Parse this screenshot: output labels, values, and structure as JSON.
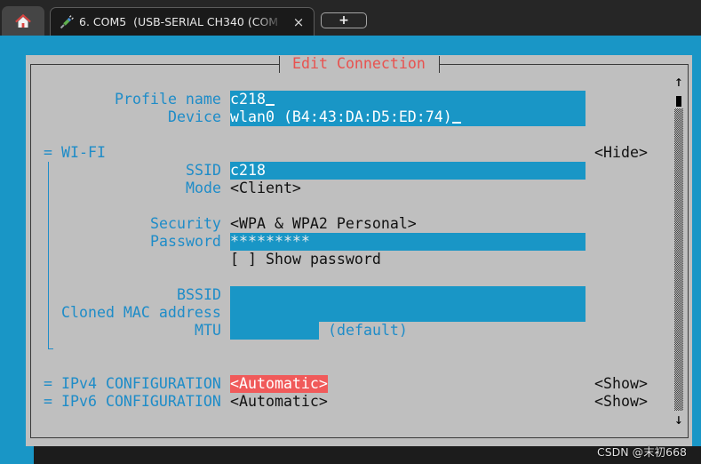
{
  "tab_bar": {
    "home_icon": "home-icon",
    "active_tab": {
      "icon": "serial-plug-icon",
      "label": "6. COM5  (USB-SERIAL CH340 (COM",
      "close_glyph": "×"
    },
    "new_tab_glyph": "+"
  },
  "dialog": {
    "title": "Edit Connection",
    "profile_name": {
      "label": "Profile name",
      "value": "c218"
    },
    "device": {
      "label": "Device",
      "value": "wlan0 (B4:43:DA:D5:ED:74)"
    },
    "wifi": {
      "marker": "=",
      "label": "WI-FI",
      "toggle": "<Hide>",
      "ssid": {
        "label": "SSID",
        "value": "c218"
      },
      "mode": {
        "label": "Mode",
        "value": "<Client>"
      },
      "security": {
        "label": "Security",
        "value": "<WPA & WPA2 Personal>"
      },
      "password": {
        "label": "Password",
        "value": "*********"
      },
      "show_password": {
        "checkbox": "[ ]",
        "label": "Show password",
        "checked": false
      },
      "bssid": {
        "label": "BSSID"
      },
      "cloned_mac": {
        "label": "Cloned MAC address"
      },
      "mtu": {
        "label": "MTU",
        "hint": "(default)"
      }
    },
    "ipv4": {
      "marker": "=",
      "label": "IPv4 CONFIGURATION",
      "value": "<Automatic>",
      "toggle": "<Show>",
      "focused": true
    },
    "ipv6": {
      "marker": "=",
      "label": "IPv6 CONFIGURATION",
      "value": "<Automatic>",
      "toggle": "<Show>"
    },
    "scrollbar": {
      "up_glyph": "↑",
      "down_glyph": "↓"
    }
  },
  "watermark": "CSDN @末初668",
  "colors": {
    "terminal_bg": "#1996c6",
    "dialog_bg": "#bfbfbf",
    "label": "#1e8cc8",
    "title": "#e8524f",
    "focus_bg": "#f05a5a"
  }
}
